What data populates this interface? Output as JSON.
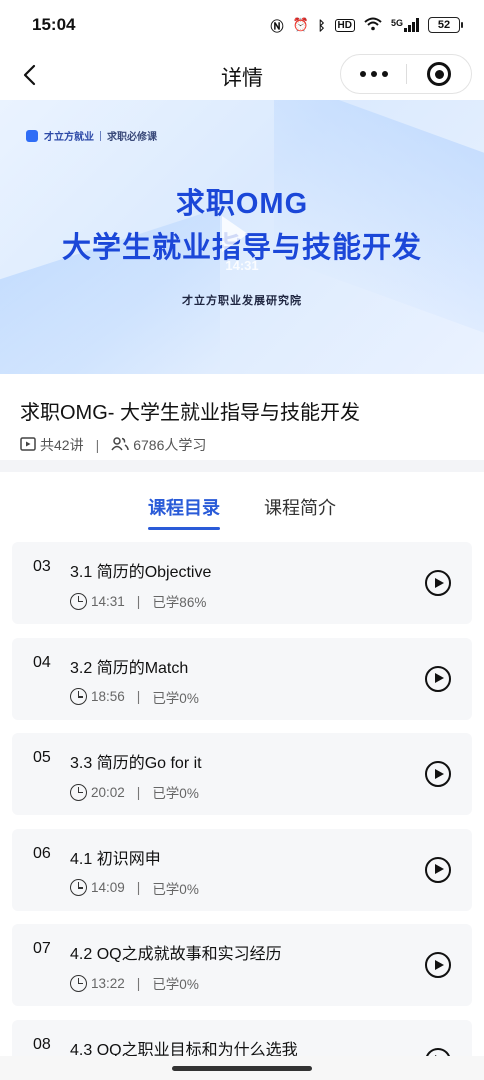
{
  "status_bar": {
    "time": "15:04",
    "icons": [
      "nfc-icon",
      "alarm-icon",
      "bluetooth-icon",
      "hd-icon",
      "wifi-icon",
      "5g-signal-icon"
    ],
    "hd_label": "HD",
    "network_label": "5G",
    "battery": "52"
  },
  "nav": {
    "title": "详情"
  },
  "banner": {
    "brand": "才立方就业",
    "tag": "求职必修课",
    "title_line1": "求职OMG",
    "title_line2": "大学生就业指导与技能开发",
    "duration": "14:31",
    "org": "才立方职业发展研究院"
  },
  "course": {
    "title": "求职OMG- 大学生就业指导与技能开发",
    "lectures": "共42讲",
    "learners": "6786人学习"
  },
  "tabs": [
    {
      "label": "课程目录",
      "active": true
    },
    {
      "label": "课程简介",
      "active": false
    }
  ],
  "lessons": [
    {
      "no": "03",
      "title": "3.1 简历的Objective",
      "duration": "14:31",
      "progress": "已学86%"
    },
    {
      "no": "04",
      "title": "3.2 简历的Match",
      "duration": "18:56",
      "progress": "已学0%"
    },
    {
      "no": "05",
      "title": "3.3 简历的Go for it",
      "duration": "20:02",
      "progress": "已学0%"
    },
    {
      "no": "06",
      "title": "4.1 初识网申",
      "duration": "14:09",
      "progress": "已学0%"
    },
    {
      "no": "07",
      "title": "4.2 OQ之成就故事和实习经历",
      "duration": "13:22",
      "progress": "已学0%"
    },
    {
      "no": "08",
      "title": "4.3 OQ之职业目标和为什么选我",
      "duration": "",
      "progress": ""
    }
  ],
  "colors": {
    "accent": "#2a5bd8",
    "banner_title": "#1b47d8"
  }
}
